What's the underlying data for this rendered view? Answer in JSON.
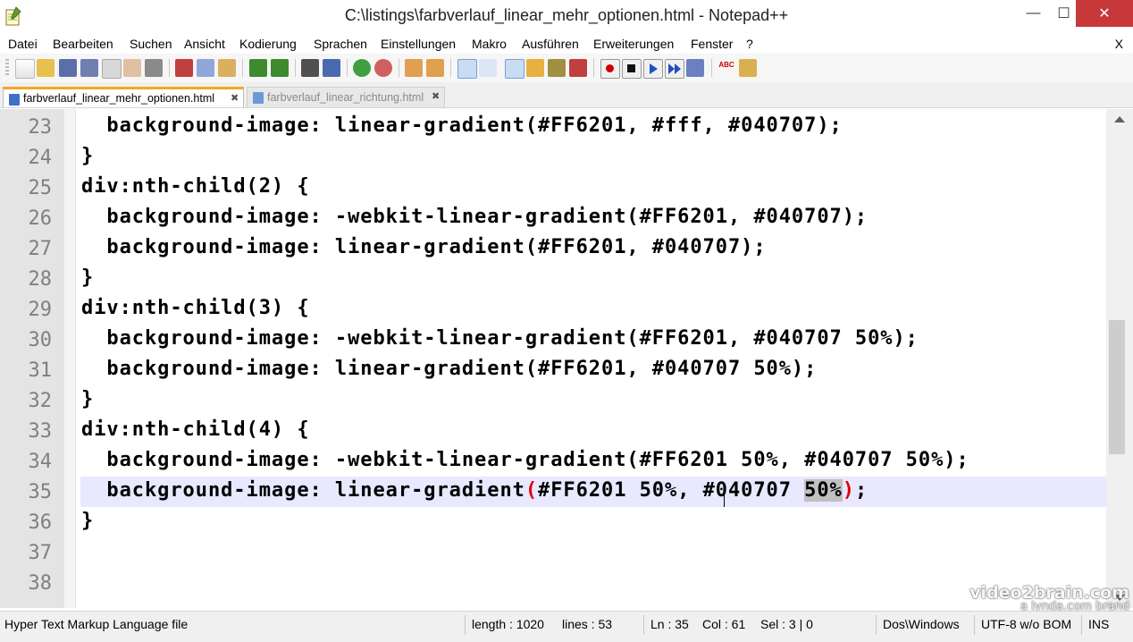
{
  "window": {
    "title": "C:\\listings\\farbverlauf_linear_mehr_optionen.html - Notepad++",
    "min_glyph": "—",
    "max_glyph": "☐",
    "close_glyph": "✕"
  },
  "menu": {
    "items": [
      "Datei",
      "Bearbeiten",
      "Suchen",
      "Ansicht",
      "Kodierung",
      "Sprachen",
      "Einstellungen",
      "Makro",
      "Ausführen",
      "Erweiterungen",
      "Fenster",
      "?"
    ],
    "close": "X"
  },
  "toolbar": {
    "icons": [
      "new-file-icon",
      "open-file-icon",
      "save-icon",
      "save-all-icon",
      "close-icon",
      "close-all-icon",
      "print-icon",
      "cut-icon",
      "copy-icon",
      "paste-icon",
      "undo-icon",
      "redo-icon",
      "find-icon",
      "replace-icon",
      "zoom-in-icon",
      "zoom-out-icon",
      "sync-vertical-icon",
      "sync-horizontal-icon",
      "word-wrap-icon",
      "show-all-chars-icon",
      "indent-guide-icon",
      "user-language-icon",
      "doc-map-icon",
      "function-list-icon",
      "record-macro-icon",
      "stop-macro-icon",
      "play-macro-icon",
      "run-macro-multiple-icon",
      "save-macro-icon",
      "spell-check-icon",
      "plugin-icon"
    ]
  },
  "tabs": [
    {
      "label": "farbverlauf_linear_mehr_optionen.html",
      "active": true,
      "close": "✖"
    },
    {
      "label": "farbverlauf_linear_richtung.html",
      "active": false,
      "close": "✖"
    }
  ],
  "editor": {
    "current_line": 35,
    "lines": [
      {
        "num": "23",
        "text": "  background-image: linear-gradient(#FF6201, #fff, #040707);"
      },
      {
        "num": "24",
        "text": "}"
      },
      {
        "num": "25",
        "text": "div:nth-child(2) {"
      },
      {
        "num": "26",
        "text": "  background-image: -webkit-linear-gradient(#FF6201, #040707);"
      },
      {
        "num": "27",
        "text": "  background-image: linear-gradient(#FF6201, #040707);"
      },
      {
        "num": "28",
        "text": "}"
      },
      {
        "num": "29",
        "text": "div:nth-child(3) {"
      },
      {
        "num": "30",
        "text": "  background-image: -webkit-linear-gradient(#FF6201, #040707 50%);"
      },
      {
        "num": "31",
        "text": "  background-image: linear-gradient(#FF6201, #040707 50%);"
      },
      {
        "num": "32",
        "text": "}"
      },
      {
        "num": "33",
        "text": "div:nth-child(4) {"
      },
      {
        "num": "34",
        "text": "  background-image: -webkit-linear-gradient(#FF6201 50%, #040707 50%);"
      },
      {
        "num": "35",
        "text": "  background-image: linear-gradient(#FF6201 50%, #040707 50%);",
        "parts": [
          "  background-image: linear-gradient",
          "(",
          "#FF6201 50%, #040707 ",
          "50%",
          ")",
          ";"
        ]
      },
      {
        "num": "36",
        "text": "}"
      },
      {
        "num": "37",
        "text": ""
      },
      {
        "num": "38",
        "text": ""
      }
    ]
  },
  "watermark": {
    "main": "video2brain.com",
    "sub": "a lynda.com brand"
  },
  "status": {
    "file_type": "Hyper Text Markup Language file",
    "length": "length : 1020",
    "lines": "lines : 53",
    "ln": "Ln : 35",
    "col": "Col : 61",
    "sel": "Sel : 3 | 0",
    "eol": "Dos\\Windows",
    "encoding": "UTF-8 w/o BOM",
    "mode": "INS"
  },
  "colors": {
    "current_line": "#e8e8ff",
    "brace_match": "#e00000",
    "selection": "#c0c0c0",
    "close_button": "#c7383a",
    "active_tab_accent": "#f5a623"
  }
}
